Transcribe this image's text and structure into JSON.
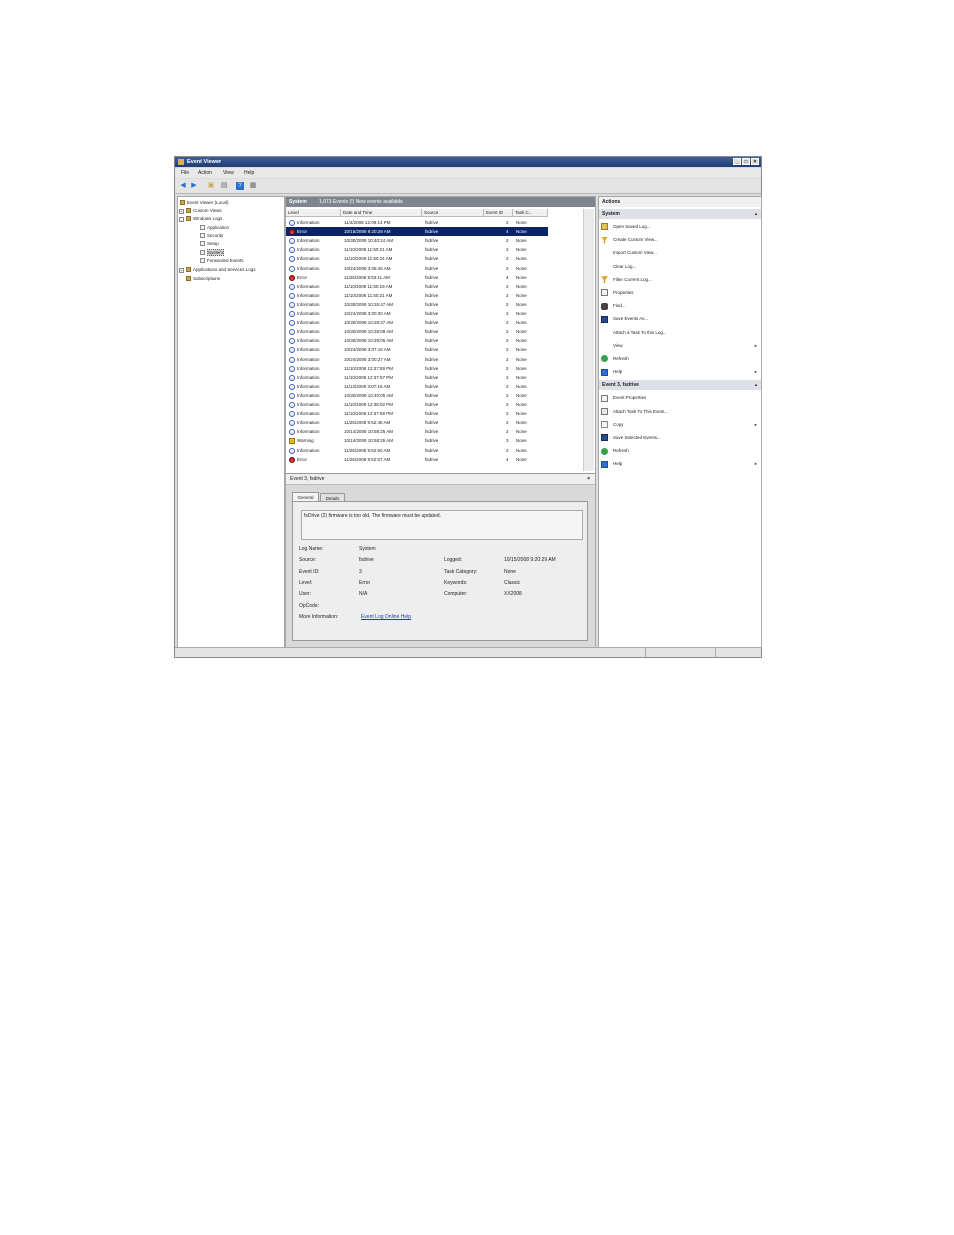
{
  "window": {
    "title": "Event Viewer",
    "buttons": [
      "_",
      "□",
      "×"
    ]
  },
  "menu": [
    "File",
    "Action",
    "View",
    "Help"
  ],
  "toolbar": {
    "icons": [
      "back-icon",
      "forward-icon",
      "up-folder-icon",
      "show-hide-tree-icon",
      "help-icon",
      "properties-icon"
    ]
  },
  "tree": {
    "items": [
      {
        "label": "Event Viewer (Local)",
        "icon": "computer-icon"
      },
      {
        "label": "Custom Views",
        "icon": "folder-icon"
      },
      {
        "label": "Windows Logs",
        "icon": "folder-icon"
      },
      {
        "label": "Application",
        "icon": "log-icon"
      },
      {
        "label": "Security",
        "icon": "log-icon"
      },
      {
        "label": "Setup",
        "icon": "log-icon"
      },
      {
        "label": "System",
        "icon": "log-icon"
      },
      {
        "label": "Forwarded Events",
        "icon": "log-icon"
      },
      {
        "label": "Applications and Services Logs",
        "icon": "folder-icon"
      },
      {
        "label": "Subscriptions",
        "icon": "subscriptions-icon"
      }
    ],
    "selected": "System"
  },
  "center": {
    "header_title": "System",
    "header_info": "1,073 Events (!) New events available",
    "columns": [
      "Level",
      "Date and Time",
      "Source",
      "Event ID",
      "Task C..."
    ],
    "rows": [
      {
        "level": "Information",
        "date": "11/4/2008 12:09:14 PM",
        "source": "fsdrive",
        "id": "2",
        "task": "None"
      },
      {
        "level": "Error",
        "date": "10/15/2008 9:20:29 AM",
        "source": "fsdrive",
        "id": "4",
        "task": "None"
      },
      {
        "level": "Information",
        "date": "10/30/2008 10:40:24 AM",
        "source": "fsdrive",
        "id": "2",
        "task": "None"
      },
      {
        "level": "Information",
        "date": "11/10/2008 11:50:21 AM",
        "source": "fsdrive",
        "id": "2",
        "task": "None"
      },
      {
        "level": "Information",
        "date": "11/10/2008 11:50:24 AM",
        "source": "fsdrive",
        "id": "2",
        "task": "None"
      },
      {
        "level": "Information",
        "date": "10/24/2008 3:08:45 AM",
        "source": "fsdrive",
        "id": "2",
        "task": "None"
      },
      {
        "level": "Error",
        "date": "11/26/2008 9:53:11 AM",
        "source": "fsdrive",
        "id": "4",
        "task": "None"
      },
      {
        "level": "Information",
        "date": "11/10/2008 11:50:19 AM",
        "source": "fsdrive",
        "id": "2",
        "task": "None"
      },
      {
        "level": "Information",
        "date": "11/10/2008 11:50:21 AM",
        "source": "fsdrive",
        "id": "2",
        "task": "None"
      },
      {
        "level": "Information",
        "date": "10/30/2008 10:26:47 AM",
        "source": "fsdrive",
        "id": "2",
        "task": "None"
      },
      {
        "level": "Information",
        "date": "10/24/2008 3:00:30 AM",
        "source": "fsdrive",
        "id": "2",
        "task": "None"
      },
      {
        "level": "Information",
        "date": "10/30/2008 10:28:27 AM",
        "source": "fsdrive",
        "id": "2",
        "task": "None"
      },
      {
        "level": "Information",
        "date": "10/30/2008 10:28:08 AM",
        "source": "fsdrive",
        "id": "2",
        "task": "None"
      },
      {
        "level": "Information",
        "date": "10/30/2008 10:29:05 AM",
        "source": "fsdrive",
        "id": "2",
        "task": "None"
      },
      {
        "level": "Information",
        "date": "10/24/2008 3:07:16 AM",
        "source": "fsdrive",
        "id": "2",
        "task": "None"
      },
      {
        "level": "Information",
        "date": "10/24/2008 3:00:27 AM",
        "source": "fsdrive",
        "id": "2",
        "task": "None"
      },
      {
        "level": "Information",
        "date": "11/10/2008 12:37:59 PM",
        "source": "fsdrive",
        "id": "2",
        "task": "None"
      },
      {
        "level": "Information",
        "date": "11/10/2008 12:37:57 PM",
        "source": "fsdrive",
        "id": "2",
        "task": "None"
      },
      {
        "level": "Information",
        "date": "11/13/2008 3:07:15 AM",
        "source": "fsdrive",
        "id": "2",
        "task": "None"
      },
      {
        "level": "Information",
        "date": "10/30/2008 10:40:05 AM",
        "source": "fsdrive",
        "id": "2",
        "task": "None"
      },
      {
        "level": "Information",
        "date": "11/10/2008 12:38:02 PM",
        "source": "fsdrive",
        "id": "2",
        "task": "None"
      },
      {
        "level": "Information",
        "date": "11/10/2008 12:37:59 PM",
        "source": "fsdrive",
        "id": "2",
        "task": "None"
      },
      {
        "level": "Information",
        "date": "11/26/2008 9:52:48 AM",
        "source": "fsdrive",
        "id": "2",
        "task": "None"
      },
      {
        "level": "Information",
        "date": "10/14/2008 10:58:25 AM",
        "source": "fsdrive",
        "id": "2",
        "task": "None"
      },
      {
        "level": "Warning",
        "date": "10/14/2008 10:58:25 AM",
        "source": "fsdrive",
        "id": "3",
        "task": "None"
      },
      {
        "level": "Information",
        "date": "11/26/2008 9:52:50 AM",
        "source": "fsdrive",
        "id": "2",
        "task": "None"
      },
      {
        "level": "Error",
        "date": "11/26/2008 9:52:57 AM",
        "source": "fsdrive",
        "id": "4",
        "task": "None"
      }
    ],
    "selected_row": 1
  },
  "detail": {
    "title": "Event 3, fsdrive",
    "close": "×",
    "tabs": [
      "General",
      "Details"
    ],
    "message": "fsDrive (2) firmware is too old. The firmware must be updated.",
    "fields_left": [
      {
        "label": "Log Name:",
        "value": "System"
      },
      {
        "label": "Source:",
        "value": "fsdrive"
      },
      {
        "label": "Event ID:",
        "value": "3"
      },
      {
        "label": "Level:",
        "value": "Error"
      },
      {
        "label": "User:",
        "value": "N/A"
      },
      {
        "label": "OpCode:",
        "value": ""
      },
      {
        "label": "More Information:",
        "value": "Event Log Online Help"
      }
    ],
    "fields_right": [
      {
        "label": "Logged:",
        "value": "10/15/2008 9:20:29 AM"
      },
      {
        "label": "Task Category:",
        "value": "None"
      },
      {
        "label": "Keywords:",
        "value": "Classic"
      },
      {
        "label": "Computer:",
        "value": "XX2008"
      }
    ]
  },
  "actions": {
    "title": "Actions",
    "system_header": "System",
    "system_items": [
      {
        "label": "Open Saved Log...",
        "icon": "open-folder-icon",
        "submenu": false
      },
      {
        "label": "Create Custom View...",
        "icon": "filter-icon",
        "submenu": false
      },
      {
        "label": "Import Custom View...",
        "icon": "",
        "submenu": false
      },
      {
        "label": "Clear Log...",
        "icon": "",
        "submenu": false
      },
      {
        "label": "Filter Current Log...",
        "icon": "filter-icon",
        "submenu": false
      },
      {
        "label": "Properties",
        "icon": "properties-icon",
        "submenu": false
      },
      {
        "label": "Find...",
        "icon": "binoculars-icon",
        "submenu": false
      },
      {
        "label": "Save Events As...",
        "icon": "save-icon",
        "submenu": false
      },
      {
        "label": "Attach a Task To this Log...",
        "icon": "",
        "submenu": false
      },
      {
        "label": "View",
        "icon": "",
        "submenu": true
      },
      {
        "label": "Refresh",
        "icon": "refresh-icon",
        "submenu": false
      },
      {
        "label": "Help",
        "icon": "help-icon",
        "submenu": true
      }
    ],
    "event_header": "Event 3, fsdrive",
    "event_items": [
      {
        "label": "Event Properties",
        "icon": "properties-icon",
        "submenu": false
      },
      {
        "label": "Attach Task To This Event...",
        "icon": "task-icon",
        "submenu": false
      },
      {
        "label": "Copy",
        "icon": "copy-icon",
        "submenu": true
      },
      {
        "label": "Save Selected Events...",
        "icon": "save-icon",
        "submenu": false
      },
      {
        "label": "Refresh",
        "icon": "refresh-icon",
        "submenu": false
      },
      {
        "label": "Help",
        "icon": "help-icon",
        "submenu": true
      }
    ]
  },
  "colors": {
    "titlebar": "#203c74",
    "selection": "#0a246a",
    "link": "#1a3fb5",
    "error": "#c52020",
    "warning": "#f5c51c",
    "info": "#3a5fc0"
  }
}
